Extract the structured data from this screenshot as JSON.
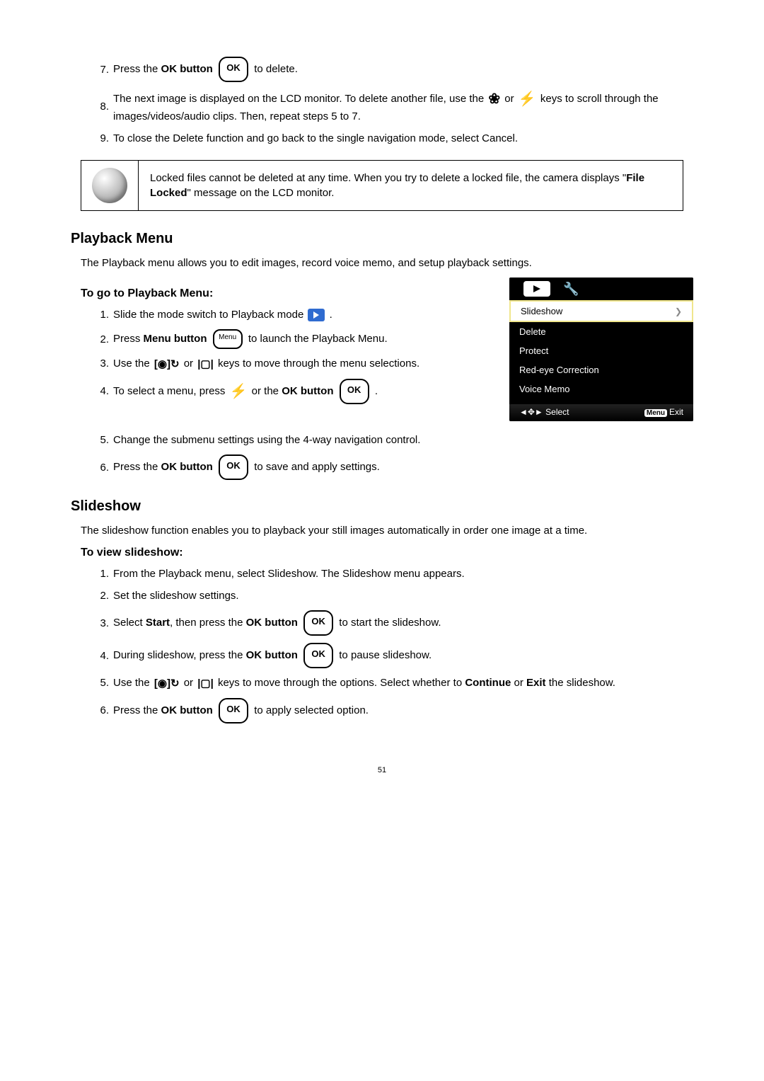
{
  "delete_cont": {
    "items": [
      {
        "num": "7.",
        "before": "Press the ",
        "bold": "OK button",
        "after": " to delete.",
        "show_ok": true
      },
      {
        "num": "8.",
        "plain_with_icons": "The next image is displayed on the LCD monitor. To delete another file, use the {MACRO} or {FLASH} keys to scroll through the images/videos/audio clips. Then, repeat steps 5 to 7."
      },
      {
        "num": "9.",
        "plain": "To close the Delete function and go back to the single navigation mode, select Cancel."
      }
    ]
  },
  "note": {
    "text_before": "Locked files cannot be deleted at any time. When you try to delete a locked file, the camera displays \"",
    "bold": "File Locked",
    "text_after": "\" message on the LCD monitor."
  },
  "section1": {
    "heading": "Playback Menu",
    "intro": "The Playback menu allows you to edit images, record voice memo, and setup playback settings.",
    "sub": "To go to Playback Menu:",
    "items": [
      {
        "num": "1.",
        "before": "Slide the mode switch to Playback mode ",
        "show_play": true,
        "after": "."
      },
      {
        "num": "2.",
        "before": "Press ",
        "bold": "Menu button",
        "show_menu": true,
        "after": " to launch the Playback Menu."
      },
      {
        "num": "3.",
        "plain_with_icons": "Use the {FACE} or {DISP} keys to move through the menu selections."
      },
      {
        "num": "4.",
        "before": "To select a menu, press ",
        "show_flash": true,
        "mid": " or the ",
        "bold": "OK button",
        "show_ok": true,
        "after": "."
      },
      {
        "num": "5.",
        "plain": "Change the submenu settings using the 4-way navigation control."
      },
      {
        "num": "6.",
        "before": "Press the ",
        "bold": "OK button",
        "show_ok": true,
        "after": " to save and apply settings."
      }
    ]
  },
  "screenshot": {
    "items": [
      "Slideshow",
      "Delete",
      "Protect",
      "Red-eye Correction",
      "Voice Memo"
    ],
    "bottom_left": "◄✥► Select",
    "menu_badge": "Menu",
    "bottom_right": "Exit"
  },
  "section2": {
    "heading": "Slideshow",
    "intro": "The slideshow function enables you to playback your still images automatically in order one image at a time.",
    "sub": "To view slideshow:",
    "items": [
      {
        "num": "1.",
        "plain": "From the Playback menu, select Slideshow. The Slideshow menu appears."
      },
      {
        "num": "2.",
        "plain": "Set the slideshow settings."
      },
      {
        "num": "3.",
        "before": "Select ",
        "bold": "Start",
        "mid": ", then press the ",
        "bold2": "OK button",
        "show_ok": true,
        "after": " to start the slideshow."
      },
      {
        "num": "4.",
        "before": "During slideshow, press the ",
        "bold": "OK button",
        "show_ok": true,
        "after": " to pause slideshow."
      },
      {
        "num": "5.",
        "plain_with_icons_cont": "Use the {FACE} or {DISP} keys to move through the options. Select whether to ",
        "bold": "Continue",
        "mid": " or ",
        "bold2": "Exit",
        "after": " the slideshow."
      },
      {
        "num": "6.",
        "before": "Press the ",
        "bold": "OK button",
        "show_ok": true,
        "after": " to apply selected option."
      }
    ]
  },
  "page_number": "51"
}
